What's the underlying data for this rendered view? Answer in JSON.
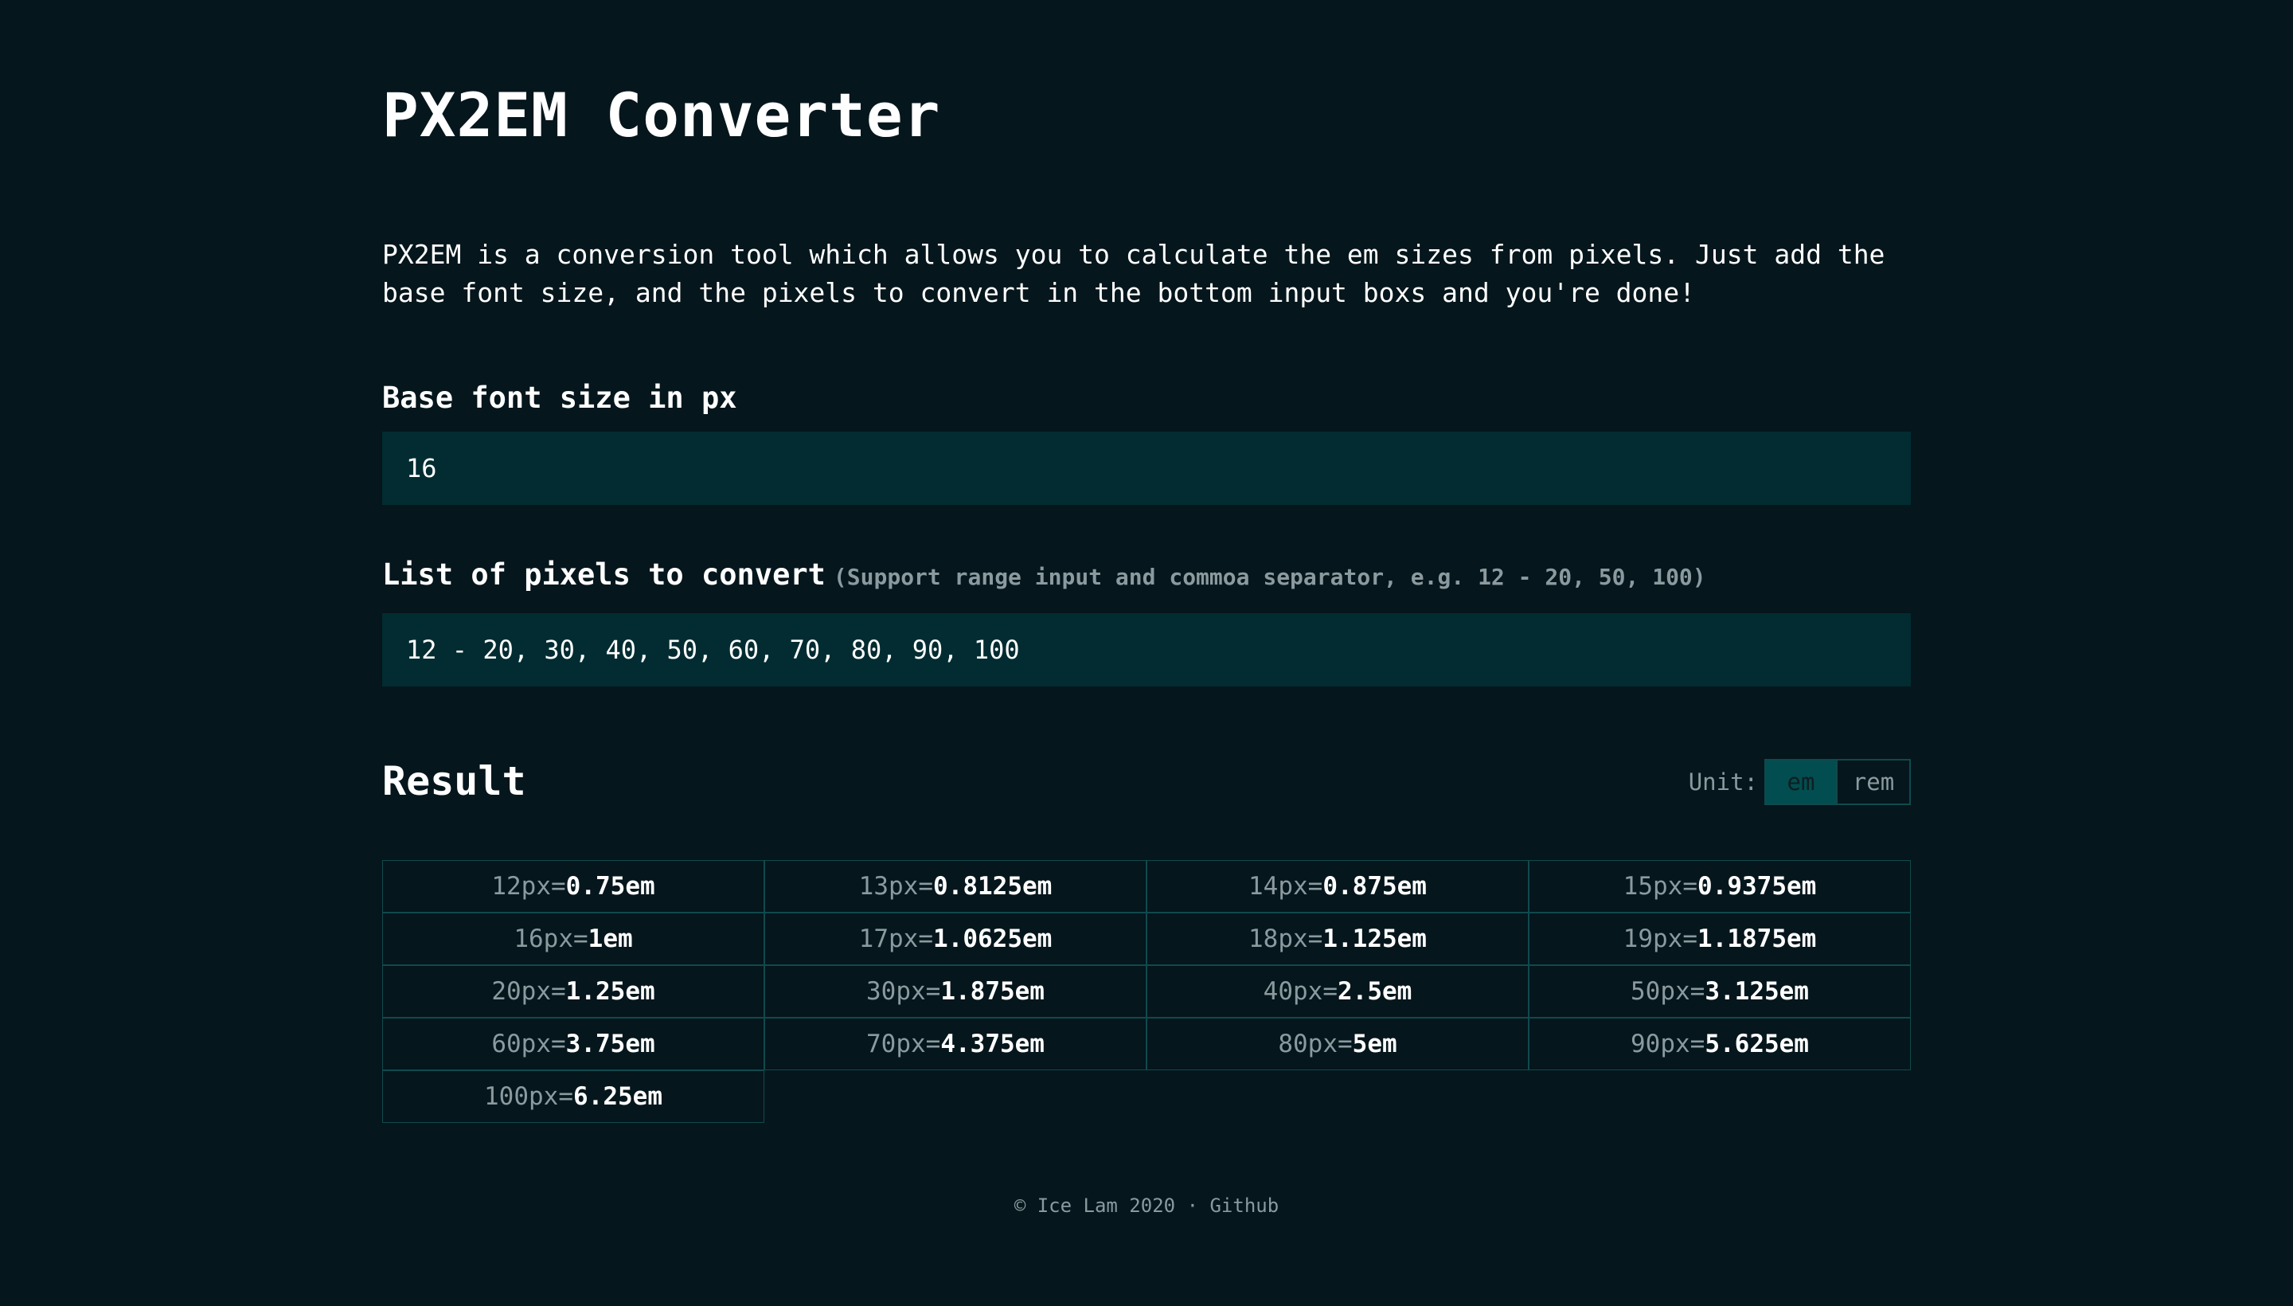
{
  "title": "PX2EM Converter",
  "intro": "PX2EM is a conversion tool which allows you to calculate the em sizes from pixels. Just add the base font size, and the pixels to convert in the bottom input boxs and you're done!",
  "base": {
    "label": "Base font size in px",
    "value": "16"
  },
  "pixels": {
    "label": "List of pixels to convert",
    "hint": "(Support range input and commoa separator, e.g. 12 - 20, 50, 100)",
    "value": "12 - 20, 30, 40, 50, 60, 70, 80, 90, 100"
  },
  "result": {
    "title": "Result",
    "unit_label": "Unit:",
    "units": [
      "em",
      "rem"
    ],
    "active_unit": "em",
    "equals": "=",
    "items": [
      {
        "px": "12px",
        "em": "0.75em"
      },
      {
        "px": "13px",
        "em": "0.8125em"
      },
      {
        "px": "14px",
        "em": "0.875em"
      },
      {
        "px": "15px",
        "em": "0.9375em"
      },
      {
        "px": "16px",
        "em": "1em"
      },
      {
        "px": "17px",
        "em": "1.0625em"
      },
      {
        "px": "18px",
        "em": "1.125em"
      },
      {
        "px": "19px",
        "em": "1.1875em"
      },
      {
        "px": "20px",
        "em": "1.25em"
      },
      {
        "px": "30px",
        "em": "1.875em"
      },
      {
        "px": "40px",
        "em": "2.5em"
      },
      {
        "px": "50px",
        "em": "3.125em"
      },
      {
        "px": "60px",
        "em": "3.75em"
      },
      {
        "px": "70px",
        "em": "4.375em"
      },
      {
        "px": "80px",
        "em": "5em"
      },
      {
        "px": "90px",
        "em": "5.625em"
      },
      {
        "px": "100px",
        "em": "6.25em"
      }
    ]
  },
  "footer": {
    "copyright": "© Ice Lam 2020",
    "separator": "·",
    "github": "Github"
  },
  "colors": {
    "background": "#05161c",
    "input_bg": "#022c31",
    "border": "#0f4a4d",
    "active_unit_bg": "#024d50",
    "muted_text": "#8a9a9e"
  }
}
